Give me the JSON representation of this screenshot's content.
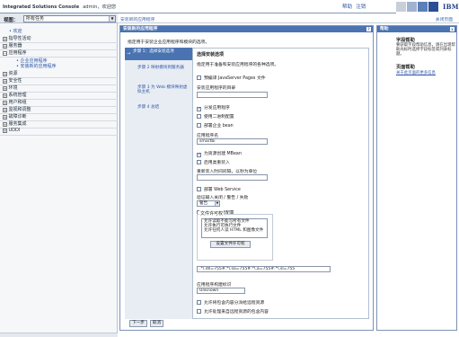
{
  "app": {
    "name": "Integrated Solutions Console",
    "user": "admin，欢迎您",
    "help_link": "帮助",
    "logout_link": "注销",
    "logo": "IBM"
  },
  "sidebar": {
    "view_label": "视图：",
    "view_value": "所有任务",
    "items": [
      {
        "label": "欢迎",
        "type": "top"
      },
      {
        "label": "指导性活动",
        "pm": "⊞"
      },
      {
        "label": "服务器",
        "pm": "⊞"
      },
      {
        "label": "应用程序",
        "pm": "⊟"
      },
      {
        "label": "企业应用程序",
        "type": "child"
      },
      {
        "label": "安装新的应用程序",
        "type": "child"
      },
      {
        "label": "资源",
        "pm": "⊞"
      },
      {
        "label": "安全性",
        "pm": "⊞"
      },
      {
        "label": "环境",
        "pm": "⊞"
      },
      {
        "label": "系统管理",
        "pm": "⊞"
      },
      {
        "label": "用户和组",
        "pm": "⊞"
      },
      {
        "label": "监视和调整",
        "pm": "⊞"
      },
      {
        "label": "故障诊断",
        "pm": "⊞"
      },
      {
        "label": "服务集成",
        "pm": "⊞"
      },
      {
        "label": "UDDI",
        "pm": "⊞"
      }
    ],
    "overlap_items": [
      {
        "label": "服务集成",
        "pm": "⊞"
      },
      {
        "label": "故障诊断",
        "pm": "⊞"
      },
      {
        "label": "服务集成",
        "pm": "⊞"
      },
      {
        "label": "UDDI",
        "pm": "⊞"
      }
    ]
  },
  "content": {
    "breadcrumb": "安装新的应用程序",
    "close_page": "关闭页面",
    "panel_title": "安装新的应用程序",
    "panel_help": "?",
    "intro": "指定用于安装企业应用程序和模块的选项。",
    "steps": [
      {
        "arrow": "→",
        "label": "步骤 1：选择安装选项"
      },
      {
        "label": "步骤 2 映射模块到服务器"
      },
      {
        "label": "步骤 3 为 Web 模块映射虚拟主机"
      },
      {
        "label": "步骤 4 总结"
      }
    ],
    "form": {
      "title": "选择安装选项",
      "desc": "指定用于准备和安装应用程序的各种选项。",
      "precompile_jsp": "预编译 JavaServer Pages 文件",
      "install_dir_label": "安装应用程序的目录",
      "install_dir_value": "",
      "distribute": "分发应用程序",
      "binary_config": "使用二进制配置",
      "deploy_ejb": "部署企业 bean",
      "app_name_label": "应用程序名",
      "app_name_value": "smartbi",
      "mbean": "为资源创建 MBean",
      "class_reload": "启用类重装入",
      "reload_interval_label": "重新装入时间间隔，以秒为单位",
      "reload_interval_value": "",
      "deploy_ws": "部署 Web Service",
      "validate_label": "验证输入关闭 / 警告 / 失败",
      "validate_value": "警告",
      "process_embedded": "进程嵌入式配置",
      "file_perm_legend": "文件许可权",
      "file_perm_options": [
        "允许读取不能写所有文件",
        "允许执行可执行文件",
        "允许任何人读 HTML 和图像文件"
      ],
      "set_perm_button": "设置文件许可权",
      "perm_value": ".*\\.dll=755#.*\\.so=755#.*\\.a=755#.*\\.sl=755",
      "build_id_label": "应用程序构建标识",
      "build_id_value": "Unknown",
      "allow_dispatch": "允许将包含内容分派给远程资源",
      "allow_service": "允许处理来自远程资源的包含内容"
    },
    "next_button": "下一步",
    "cancel_button": "取消"
  },
  "help": {
    "title": "帮助",
    "close": "x",
    "field_help_heading": "字段帮助",
    "field_help_text": "要获取字段帮助信息，请在出现帮助光标时选择字段标签或列表标题。",
    "page_help_heading": "页面帮助",
    "page_help_link": "关于此页面的更多信息"
  }
}
